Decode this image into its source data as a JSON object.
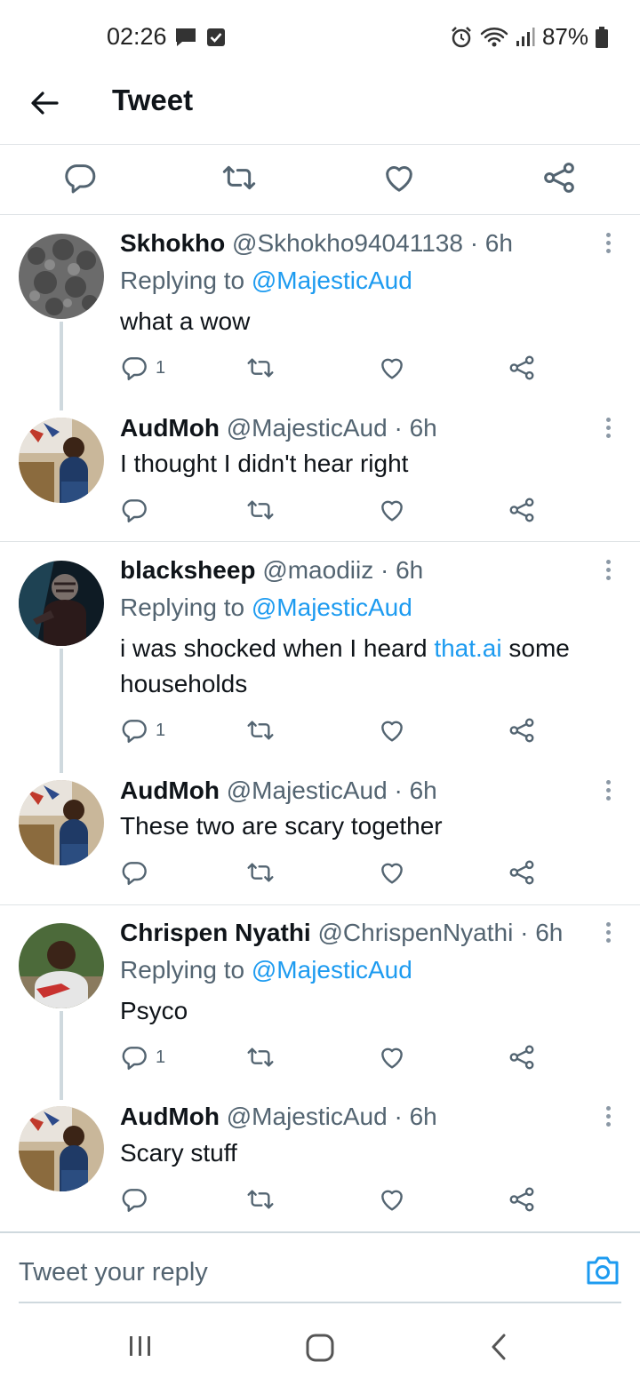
{
  "status_bar": {
    "time": "02:26",
    "battery": "87%"
  },
  "header": {
    "title": "Tweet"
  },
  "colors": {
    "accent": "#1d9bf0",
    "secondary_text": "#536471",
    "icon": "#536471"
  },
  "tweets": [
    {
      "name": "Skhokho",
      "handle": "@Skhokho94041138",
      "dot": "·",
      "time": "6h",
      "replying_prefix": "Replying to",
      "replying_to": "@MajesticAud",
      "text": "what a wow",
      "reply_count": "1"
    },
    {
      "name": "AudMoh",
      "handle": "@MajesticAud",
      "dot": "·",
      "time": "6h",
      "text": "I thought I didn't hear right"
    },
    {
      "name": "blacksheep",
      "handle": "@maodiiz",
      "dot": "·",
      "time": "6h",
      "replying_prefix": "Replying to",
      "replying_to": "@MajesticAud",
      "text_before": "i was shocked when I heard ",
      "text_link": "that.ai",
      "text_after": " some households",
      "reply_count": "1"
    },
    {
      "name": "AudMoh",
      "handle": "@MajesticAud",
      "dot": "·",
      "time": "6h",
      "text": "These two are scary together"
    },
    {
      "name": "Chrispen Nyathi",
      "handle": "@ChrispenNyathi",
      "dot": "·",
      "time": "6h",
      "replying_prefix": "Replying to",
      "replying_to": "@MajesticAud",
      "text": "Psyco",
      "reply_count": "1"
    },
    {
      "name": "AudMoh",
      "handle": "@MajesticAud",
      "dot": "·",
      "time": "6h",
      "text": "Scary stuff"
    }
  ],
  "composer": {
    "placeholder": "Tweet your reply"
  },
  "icons": {
    "reply": "reply-icon",
    "retweet": "retweet-icon",
    "like": "heart-icon",
    "share": "share-icon",
    "more": "more-icon",
    "camera": "camera-icon",
    "back": "back-arrow-icon"
  }
}
